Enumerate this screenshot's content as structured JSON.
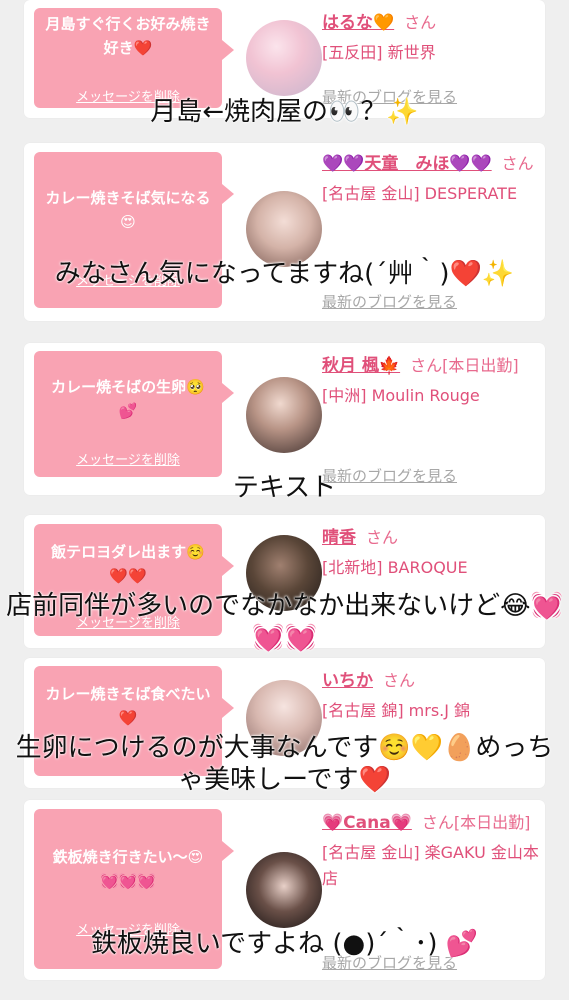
{
  "delete_label": "メッセージを削除",
  "blog_label": "最新のブログを見る",
  "cards": [
    {
      "message": "月島すぐ行くお好み焼き好き❤️",
      "name": "はるな🧡",
      "san": "さん",
      "shop": "[五反田] 新世界"
    },
    {
      "message": "カレー焼きそば気になる😍",
      "name": "💜💜天童　みほ💜💜",
      "san": "さん",
      "shop": "[名古屋 金山] DESPERATE"
    },
    {
      "message": "カレー焼そばの生卵🥺💕",
      "name": "秋月 楓🍁",
      "san": "さん[本日出勤]",
      "shop": "[中洲] Moulin Rouge"
    },
    {
      "message": "飯テロヨダレ出ます☺️❤️❤️",
      "name": "晴香",
      "san": "さん",
      "shop": "[北新地] BAROQUE"
    },
    {
      "message": "カレー焼きそば食べたい❤️",
      "name": "いちか",
      "san": "さん",
      "shop": "[名古屋 錦] mrs.J 錦"
    },
    {
      "message": "鉄板焼き行きたい〜😍💓💓💓",
      "name": "💗Cana💗",
      "san": "さん[本日出勤]",
      "shop": "[名古屋 金山] 楽GAKU 金山本店"
    }
  ],
  "captions": [
    "月島←焼肉屋の👀？✨",
    "みなさん気になってますね(´艸｀)❤️✨",
    "テキスト",
    "店前同伴が多いのでなかなか出来ないけど😂💓💓💓",
    "生卵につけるのが大事なんです☺️💛🥚めっちゃ美味しーです❤️",
    "鉄板焼良いですよね (●)´｀･) 💕"
  ]
}
